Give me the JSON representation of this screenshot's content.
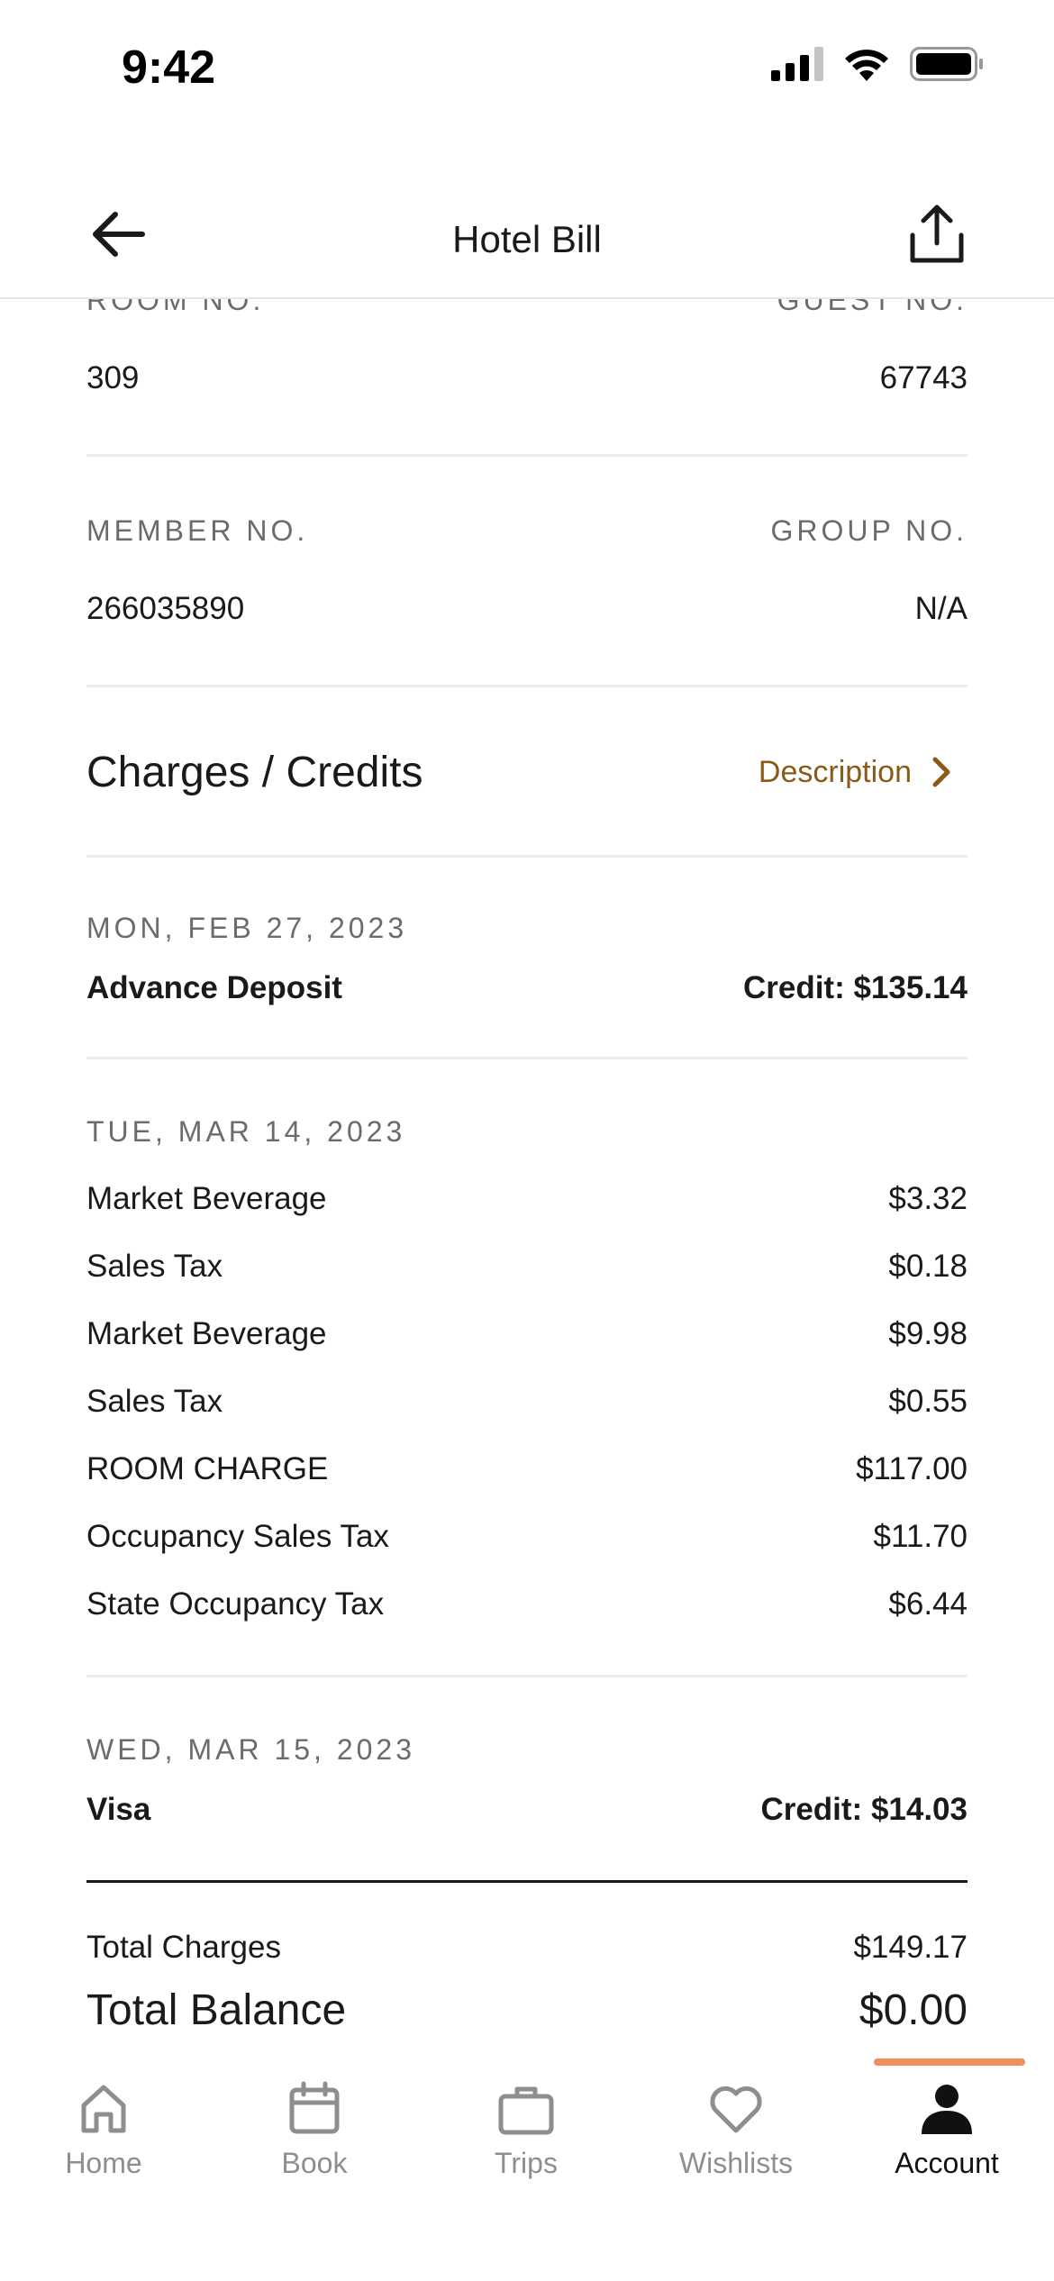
{
  "status_bar": {
    "time": "9:42"
  },
  "header": {
    "title": "Hotel Bill"
  },
  "info": {
    "room_label": "ROOM NO.",
    "room_value": "309",
    "guest_label": "GUEST NO.",
    "guest_value": "67743",
    "member_label": "MEMBER NO.",
    "member_value": "266035890",
    "group_label": "GROUP NO.",
    "group_value": "N/A"
  },
  "charges": {
    "title": "Charges / Credits",
    "description_link": "Description",
    "accent_color": "#8a5a18",
    "groups": [
      {
        "date": "MON, FEB 27, 2023",
        "items": [
          {
            "label": "Advance Deposit",
            "amount": "Credit: $135.14",
            "emphasis": true
          }
        ]
      },
      {
        "date": "TUE, MAR 14, 2023",
        "items": [
          {
            "label": "Market Beverage",
            "amount": "$3.32"
          },
          {
            "label": "Sales Tax",
            "amount": "$0.18"
          },
          {
            "label": "Market Beverage",
            "amount": "$9.98"
          },
          {
            "label": "Sales Tax",
            "amount": "$0.55"
          },
          {
            "label": "ROOM CHARGE",
            "amount": "$117.00"
          },
          {
            "label": "Occupancy Sales Tax",
            "amount": "$11.70"
          },
          {
            "label": "State Occupancy Tax",
            "amount": "$6.44"
          }
        ]
      },
      {
        "date": "WED, MAR 15, 2023",
        "items": [
          {
            "label": "Visa",
            "amount": "Credit: $14.03",
            "emphasis": true
          }
        ]
      }
    ]
  },
  "totals": {
    "charges_label": "Total Charges",
    "charges_value": "$149.17",
    "balance_label": "Total Balance",
    "balance_value": "$0.00"
  },
  "nav": {
    "home": "Home",
    "book": "Book",
    "trips": "Trips",
    "wishlists": "Wishlists",
    "account": "Account",
    "active": "account",
    "active_color": "#ef8f5a",
    "icons": [
      "home-icon",
      "calendar-icon",
      "briefcase-icon",
      "heart-icon",
      "person-icon"
    ]
  }
}
